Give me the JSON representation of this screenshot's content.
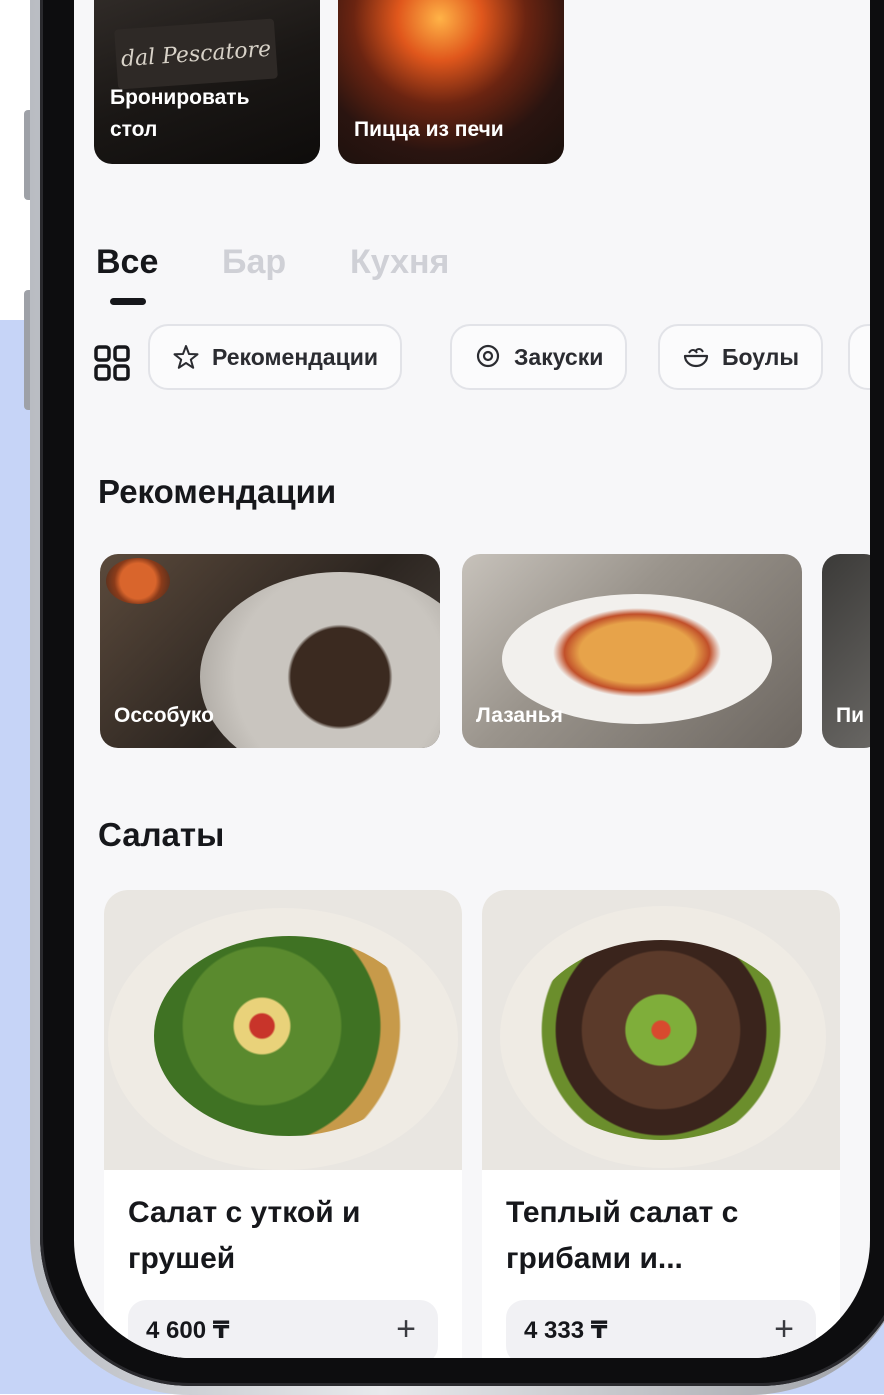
{
  "top_cards": [
    {
      "label_line1": "Бронировать",
      "label_line2": "стол",
      "sign": "dal Pescatore"
    },
    {
      "label": "Пицца из печи"
    }
  ],
  "tabs": [
    {
      "label": "Все",
      "active": true
    },
    {
      "label": "Бар",
      "active": false
    },
    {
      "label": "Кухня",
      "active": false
    }
  ],
  "chips": [
    {
      "label": "Рекомендации",
      "icon": "star-icon"
    },
    {
      "label": "Закуски",
      "icon": "location-pin-icon"
    },
    {
      "label": "Боулы",
      "icon": "bowl-icon"
    }
  ],
  "recommendations": {
    "title": "Рекомендации",
    "items": [
      {
        "label": "Оссобуко"
      },
      {
        "label": "Лазанья"
      },
      {
        "label": "Пи"
      }
    ]
  },
  "salads": {
    "title": "Салаты",
    "items": [
      {
        "name": "Салат с уткой и грушей",
        "price": "4 600 ₸"
      },
      {
        "name": "Теплый салат с грибами и...",
        "price": "4 333 ₸"
      }
    ]
  },
  "colors": {
    "background_accent": "#c6d4f7",
    "text_primary": "#16171b",
    "tab_inactive": "#cfd0d6"
  }
}
